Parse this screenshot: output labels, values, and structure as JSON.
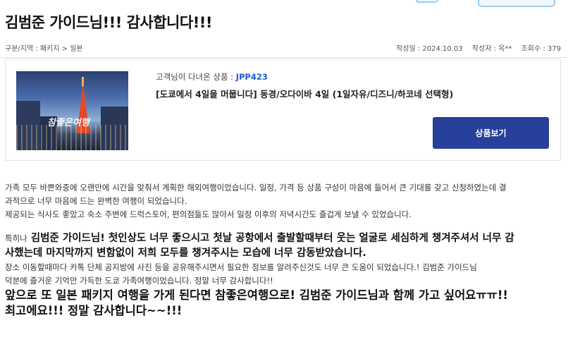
{
  "post": {
    "title": "김범준 가이드님!!! 감사합니다!!!",
    "breadcrumb": "구분/지역 : 패키지 > 일본",
    "date": "작성일 : 2024.10.03",
    "author": "작성자 : 옥**",
    "views": "조회수 : 379"
  },
  "product": {
    "label_prefix": "고객님이 다녀온 상품 :",
    "code": "JPP423",
    "name": "[도쿄에서 4일을 머뭅니다] 동경/오다이바 4일 (1일자유/디즈니/하코네 선택형)",
    "image_watermark": "참좋은여행",
    "view_button": "상품보기"
  },
  "content": {
    "line1": "가족 모두 바쁜와중에 오랜만에 시간을 맞춰서 계획한 해외여행이었습니다. 일정, 가격 등 상품 구성이 마음에 들어서 큰 기대를 갖고 신청하였는데 결",
    "line2": "과적으로 너무 마음에 드는 완벽한 여행이 되었습니다.",
    "line3": "제공되는 식사도 좋았고 숙소 주변에 드럭스토어, 편의점들도 많아서 일정 이후의 저녁시간도 즐겁게 보낼 수 있었습니다.",
    "bold_prefix": "특히나",
    "bold1": " 김범준 가이드님! 첫인상도 너무 좋으시고 첫날 공항에서 출발할때부터 웃는 얼굴로 세심하게 챙겨주셔서 너무 감",
    "bold2": "사했는데 마지막까지 변함없이 저희 모두를 챙겨주시는 모습에 너무 감동받았습니다.",
    "line4": "장소 이동할때마다 카톡 단체 공지방에 사진 등을 공유해주시면서 필요한 정보를 알려주신것도 너무 큰 도움이 되었습니다.! 김범준 가이드님",
    "line5": "덕분에 즐거운 기억만 가득한 도쿄 가족여행이었습니다. 정말 너무 감사합니다!!",
    "bigger1": "앞으로 또 일본 패키지 여행을 가게 된다면 참좋은여행으로! 김범준 가이드님과 함께 가고 싶어요ㅠㅠ!!",
    "bigger2": "최고에요!!! 정말 감사합니다~~!!!"
  },
  "colors": {
    "accent_button": "#27409a",
    "product_code": "#1e5fd6"
  }
}
